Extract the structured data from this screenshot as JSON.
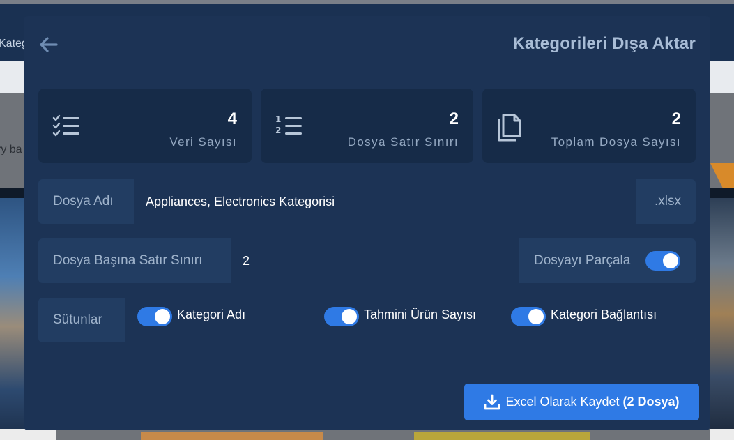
{
  "background": {
    "header_text": "Kategorie",
    "body_text": "ry ba"
  },
  "modal": {
    "title": "Kategorileri Dışa Aktar",
    "stats": [
      {
        "icon": "checklist-icon",
        "value": "4",
        "label": "Veri Sayısı"
      },
      {
        "icon": "numbered-list-icon",
        "value": "2",
        "label": "Dosya Satır Sınırı"
      },
      {
        "icon": "copy-files-icon",
        "value": "2",
        "label": "Toplam Dosya Sayısı"
      }
    ],
    "file_name": {
      "label": "Dosya Adı",
      "value": "Appliances, Electronics Kategorisi",
      "extension": ".xlsx"
    },
    "row_limit": {
      "label": "Dosya Başına Satır Sınırı",
      "value": "2",
      "split_label": "Dosyayı Parçala",
      "split_enabled": true
    },
    "columns": {
      "label": "Sütunlar",
      "items": [
        {
          "label": "Kategori Adı",
          "enabled": true
        },
        {
          "label": "Tahmini Ürün Sayısı",
          "enabled": true
        },
        {
          "label": "Kategori Bağlantısı",
          "enabled": true
        }
      ]
    },
    "save_button": {
      "label": "Excel Olarak Kaydet",
      "count_label": "(2 Dosya)"
    }
  },
  "colors": {
    "accent": "#2f7ae5",
    "modal_bg": "#1c3355",
    "card_bg": "#162b48",
    "row_bg": "#223d62"
  }
}
